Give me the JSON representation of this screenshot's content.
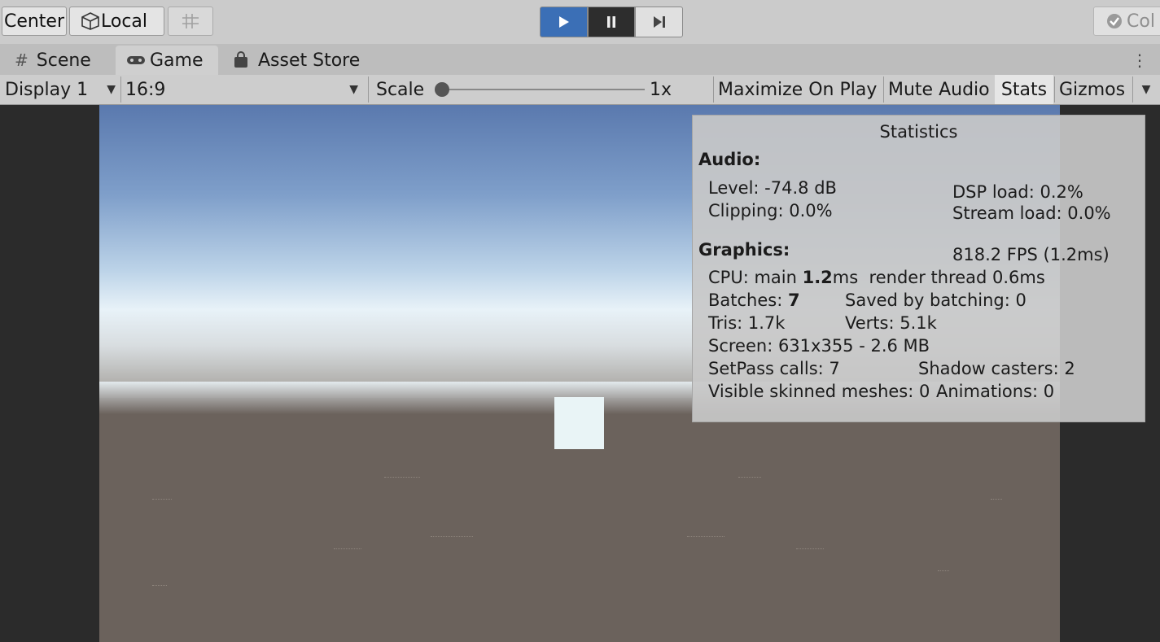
{
  "toolbar": {
    "center_label": "Center",
    "local_label": "Local",
    "collab_label": "Col"
  },
  "tabs": [
    {
      "label": "Scene",
      "icon": "grid-icon"
    },
    {
      "label": "Game",
      "icon": "gamepad-icon"
    },
    {
      "label": "Asset Store",
      "icon": "bag-icon"
    }
  ],
  "controls": {
    "display": "Display 1",
    "aspect": "16:9",
    "scale_label": "Scale",
    "scale_value": "1x",
    "scale_fraction": 0,
    "maximize": "Maximize On Play",
    "mute": "Mute Audio",
    "stats": "Stats",
    "gizmos": "Gizmos"
  },
  "stats": {
    "title": "Statistics",
    "audio_header": "Audio:",
    "level": "Level: -74.8 dB",
    "dsp": "DSP load: 0.2%",
    "clipping": "Clipping: 0.0%",
    "stream": "Stream load: 0.0%",
    "graphics_header": "Graphics:",
    "fps": "818.2 FPS (1.2ms)",
    "cpu_prefix": "CPU: main ",
    "cpu_main": "1.2",
    "cpu_suffix": "ms  render thread 0.6ms",
    "batches_prefix": "Batches: ",
    "batches": "7",
    "saved": "Saved by batching: 0",
    "tris": "Tris: 1.7k",
    "verts": "Verts: 5.1k",
    "screen": "Screen: 631x355 - 2.6 MB",
    "setpass": "SetPass calls: 7",
    "shadow": "Shadow casters: 2",
    "skinned": "Visible skinned meshes: 0",
    "animations": "Animations: 0"
  },
  "colors": {
    "play_active": "#3b6fb6",
    "panel_bg": "#cbcbcb",
    "ground": "#6b625c"
  }
}
